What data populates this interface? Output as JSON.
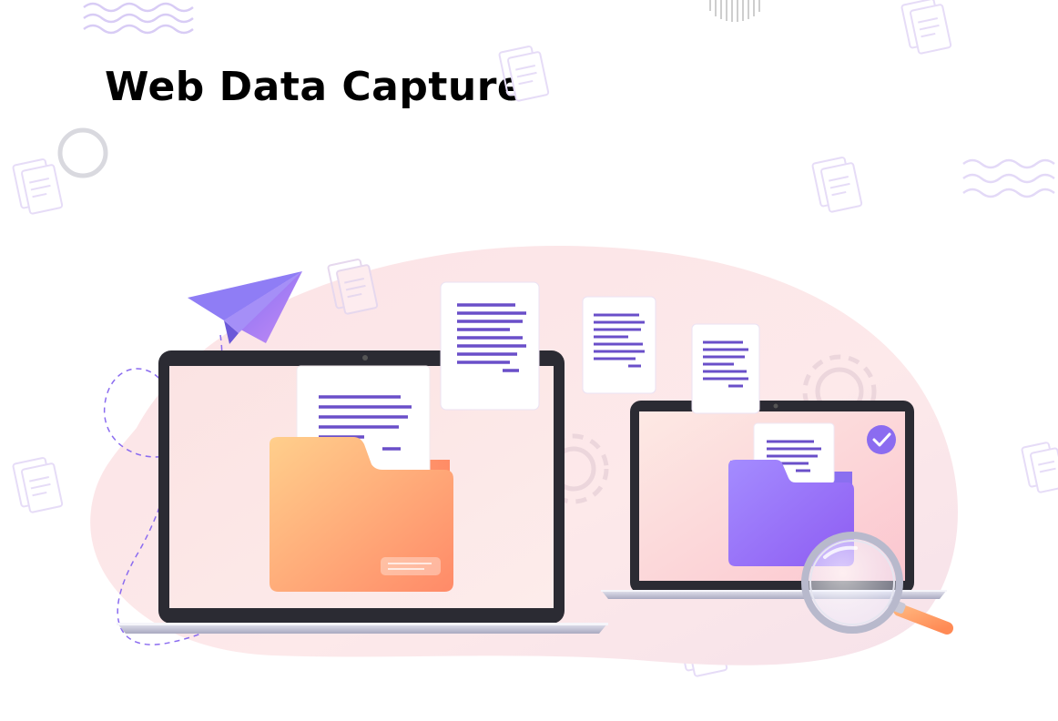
{
  "header": {
    "title": "Web Data Capture"
  },
  "colors": {
    "accent_purple": "#8b6cf0",
    "folder_orange": "#ff9a6e",
    "folder_purple": "#9a7cf5",
    "blob_pink": "#fce4e4",
    "laptop_frame": "#2b2b33",
    "decor_lavender": "#d8ccf5"
  },
  "icons": [
    "paper-plane-icon",
    "folder-icon",
    "document-icon",
    "gear-icon",
    "checkmark-badge-icon",
    "magnifying-glass-icon",
    "wave-pattern-icon",
    "circle-ring-icon"
  ]
}
